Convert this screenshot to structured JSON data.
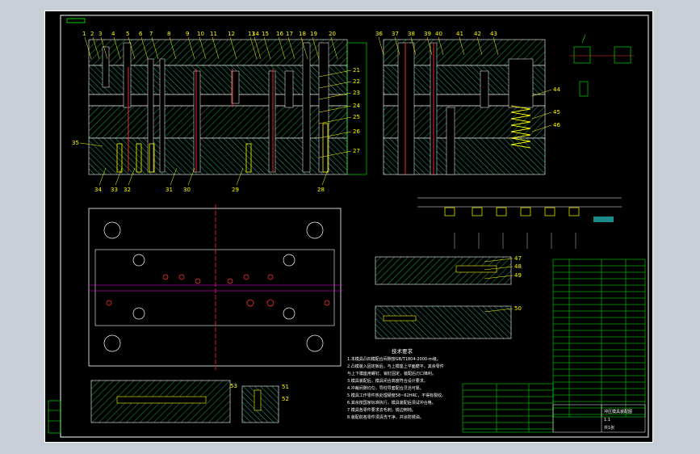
{
  "drawing": {
    "part_labels_top": [
      "1",
      "2",
      "3",
      "4",
      "5",
      "6",
      "7",
      "8",
      "9",
      "10",
      "11",
      "12",
      "13",
      "14",
      "15",
      "16",
      "17",
      "18",
      "19",
      "20"
    ],
    "part_labels_right_top": [
      "36",
      "37",
      "38",
      "39",
      "40",
      "41",
      "42",
      "43"
    ],
    "part_labels_right_side": [
      "21",
      "22",
      "23",
      "24",
      "25",
      "26",
      "27"
    ],
    "part_labels_bottom_left": [
      "34",
      "33",
      "32",
      "31",
      "30",
      "29",
      "28"
    ],
    "part_labels_misc": {
      "left_35": "35",
      "right_44": "44",
      "right_45": "45",
      "right_46": "46"
    },
    "section_labels_right": [
      "47",
      "48",
      "49",
      "50"
    ],
    "section_labels_bottom": [
      "53",
      "51",
      "52"
    ],
    "tech_notes_title": "技术要求",
    "tech_notes": [
      "1.本模具凸凹模配合间隙按GB/T1804-2000-m级。",
      "2.凸模装入固定板后，与上模座上平面磨平，其余零件",
      "  与上下模座用螺钉、销钉固定，装配后刃口锋利。",
      "3.模具装配后，模具闭合高度符合设计要求。",
      "4.冲裁间隙均匀，导柱导套配合灵活可靠。",
      "5.模具工作零件热处理硬度58~62HRC，不得有裂纹。",
      "6.其余按国家标准执行，模具装配后须试冲合格。",
      "7.模具各零件要求去毛刺，锐边倒钝。",
      "8.装配前各零件须清洗干净，并涂防锈油。"
    ],
    "title_block": {
      "name": "冲压模具装配图",
      "scale": "1:1",
      "sheet": "共1张"
    }
  }
}
